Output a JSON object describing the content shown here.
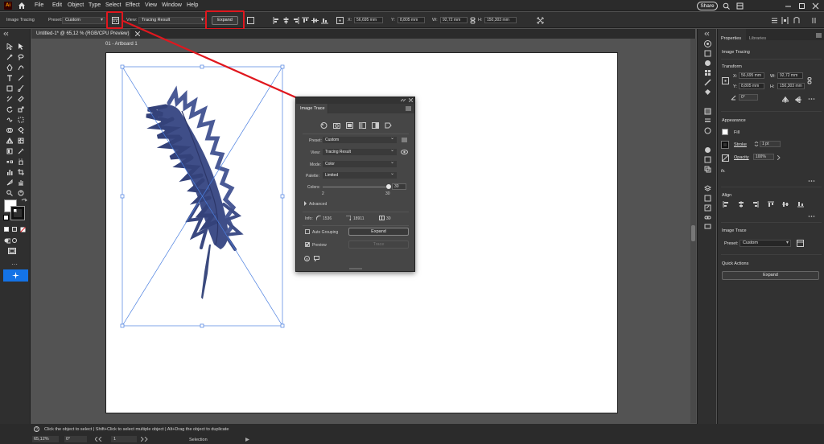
{
  "menubar": {
    "items": [
      "File",
      "Edit",
      "Object",
      "Type",
      "Select",
      "Effect",
      "View",
      "Window",
      "Help"
    ],
    "share_label": "Share"
  },
  "control_bar": {
    "mode_label": "Image Tracing",
    "preset_label": "Preset:",
    "preset_value": "Custom",
    "view_label": "View:",
    "view_value": "Tracing Result",
    "expand_label": "Expand",
    "x_label": "X:",
    "x_value": "56,695 mm",
    "y_label": "Y:",
    "y_value": "8,805 mm",
    "w_label": "W:",
    "w_value": "92,72 mm",
    "h_label": "H:",
    "h_value": "150,303 mm"
  },
  "document": {
    "tab_title": "Untitled-1* @ 65,12 % (RGB/CPU Preview)",
    "artboard_label": "01 - Artboard 1"
  },
  "image_trace_panel": {
    "title": "Image Trace",
    "preset_label": "Preset:",
    "preset_value": "Custom",
    "view_label": "View:",
    "view_value": "Tracing Result",
    "mode_label": "Mode:",
    "mode_value": "Color",
    "palette_label": "Palette:",
    "palette_value": "Limited",
    "colors_label": "Colors:",
    "colors_value": "30",
    "colors_min": "2",
    "colors_max": "30",
    "colors_level": 1.0,
    "advanced_label": "Advanced",
    "info_label": "Info:",
    "info_paths": "1536",
    "info_anchors": "18911",
    "info_colors": "30",
    "auto_grouping_label": "Auto Grouping",
    "expand_label": "Expand",
    "preview_label": "Preview",
    "trace_label": "Trace"
  },
  "properties_panel": {
    "tab_properties": "Properties",
    "tab_libraries": "Libraries",
    "selection_type": "Image Tracing",
    "transform_title": "Transform",
    "x_label": "X:",
    "x_value": "56,695 mm",
    "y_label": "Y:",
    "y_value": "8,805 mm",
    "w_label": "W:",
    "w_value": "92,72 mm",
    "h_label": "H:",
    "h_value": "150,303 mm",
    "rotate_value": "0°",
    "appearance_title": "Appearance",
    "fill_label": "Fill",
    "stroke_label": "Stroke",
    "stroke_value": "1 pt",
    "opacity_label": "Opacity",
    "opacity_value": "100%",
    "fx_label": "fx.",
    "align_title": "Align",
    "image_trace_title": "Image Trace",
    "preset_label": "Preset:",
    "preset_value": "Custom",
    "quick_actions_title": "Quick Actions",
    "expand_label": "Expand"
  },
  "status": {
    "hint": "Click the object to select  |  Shift+Click to select multiple object  |  Alt+Drag the object to duplicate",
    "zoom": "65,12%",
    "rotation": "0°",
    "artboard_num": "1",
    "tool_name": "Selection"
  },
  "colors": {
    "accent_red": "#e0171e",
    "selection_blue": "#4a7fe0",
    "feather": "#3d4d86",
    "active_tool": "#1473e6"
  }
}
